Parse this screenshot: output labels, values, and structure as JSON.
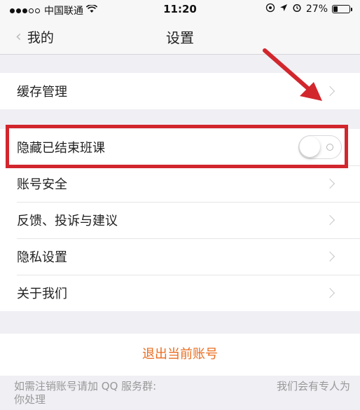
{
  "status_bar": {
    "carrier": "中国联通",
    "time": "11:20",
    "battery_percent": "27%",
    "signal_dots_filled": 3,
    "signal_dots_total": 5,
    "battery_level": 0.27
  },
  "nav": {
    "back_label": "我的",
    "title": "设置"
  },
  "settings": {
    "cache": "缓存管理",
    "hide_finished": "隐藏已结束班课",
    "hide_finished_on": false,
    "account_security": "账号安全",
    "feedback": "反馈、投诉与建议",
    "privacy": "隐私设置",
    "about": "关于我们"
  },
  "logout_label": "退出当前账号",
  "footer": {
    "line_a": "如需注销账号请加 QQ 服务群:",
    "line_b": "我们会有专人为",
    "line_c": "你处理"
  },
  "colors": {
    "accent": "#ea6c1e",
    "annotation_red": "#d2262d"
  },
  "icons": [
    "wifi-icon",
    "location-icon",
    "navigation-icon",
    "alarm-icon",
    "battery-icon",
    "chevron-left-icon",
    "chevron-right-icon",
    "annotation-arrow"
  ]
}
